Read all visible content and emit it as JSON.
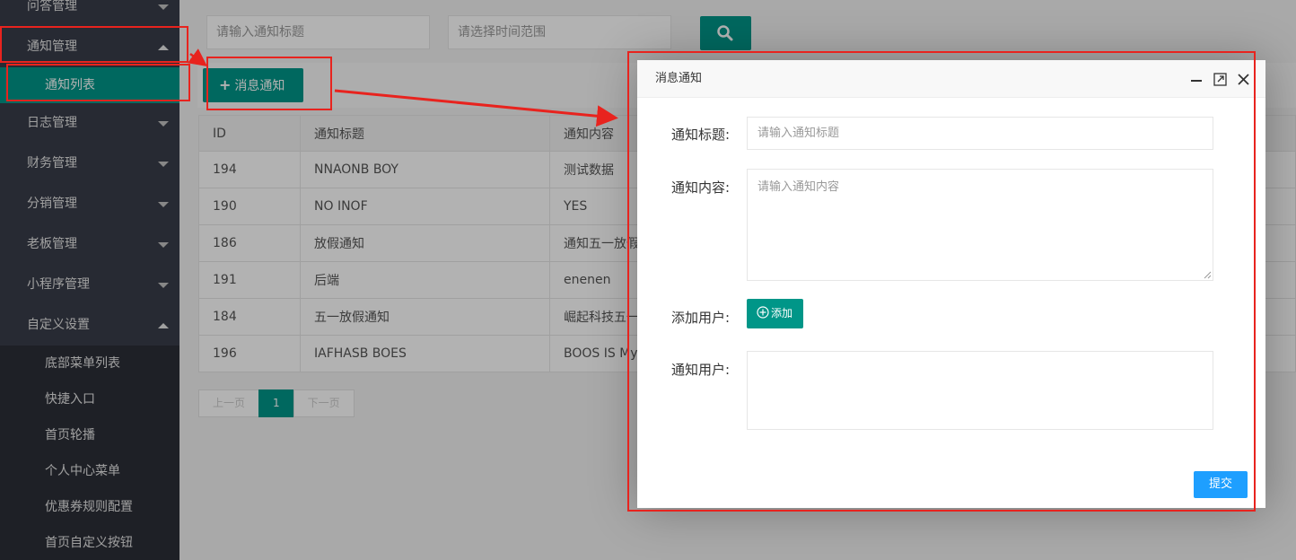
{
  "sidebar": {
    "items": [
      {
        "label": "问答管理",
        "expanded": false
      },
      {
        "label": "通知管理",
        "expanded": true
      },
      {
        "label": "日志管理",
        "expanded": false
      },
      {
        "label": "财务管理",
        "expanded": false
      },
      {
        "label": "分销管理",
        "expanded": false
      },
      {
        "label": "老板管理",
        "expanded": false
      },
      {
        "label": "小程序管理",
        "expanded": false
      },
      {
        "label": "自定义设置",
        "expanded": true
      }
    ],
    "notice_sub": "通知列表",
    "custom_subs": [
      "底部菜单列表",
      "快捷入口",
      "首页轮播",
      "个人中心菜单",
      "优惠券规则配置",
      "首页自定义按钮"
    ]
  },
  "search": {
    "title_placeholder": "请输入通知标题",
    "time_placeholder": "请选择时间范围",
    "search_icon": "search-icon"
  },
  "toolbar": {
    "add_label": "消息通知"
  },
  "table": {
    "headers": [
      "ID",
      "通知标题",
      "通知内容"
    ],
    "rows": [
      [
        "194",
        "NNAONB BOY",
        "测试数据"
      ],
      [
        "190",
        "NO INOF",
        "YES"
      ],
      [
        "186",
        "放假通知",
        "通知五一放假"
      ],
      [
        "191",
        "后端",
        "enenen"
      ],
      [
        "184",
        "五一放假通知",
        "崛起科技五一"
      ],
      [
        "196",
        "IAFHASB BOES",
        "BOOS IS My"
      ]
    ]
  },
  "pager": {
    "prev": "上一页",
    "current": "1",
    "next": "下一页"
  },
  "modal": {
    "title": "消息通知",
    "title_label": "通知标题:",
    "title_placeholder": "请输入通知标题",
    "content_label": "通知内容:",
    "content_placeholder": "请输入通知内容",
    "add_user_label": "添加用户:",
    "add_button": "添加",
    "notify_users_label": "通知用户:",
    "submit": "提交"
  },
  "colors": {
    "accent": "#009688",
    "submit": "#1e9fff",
    "sidebar": "#393d49",
    "annotation": "#e8231e"
  }
}
